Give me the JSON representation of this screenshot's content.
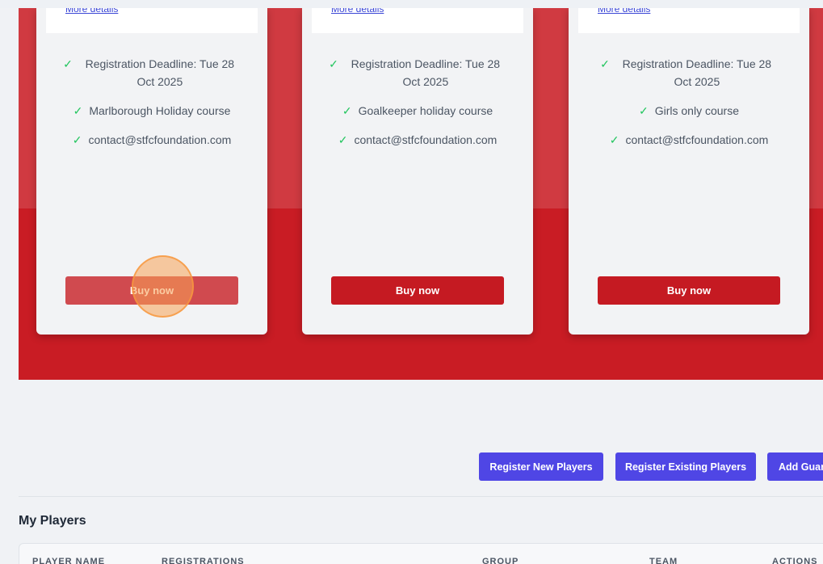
{
  "courses": [
    {
      "more_link": "More details",
      "deadline": "Registration Deadline: Tue 28 Oct 2025",
      "description": "Marlborough Holiday course",
      "contact": "contact@stfcfoundation.com",
      "buy_label": "Buy now"
    },
    {
      "more_link": "More details",
      "deadline": "Registration Deadline: Tue 28 Oct 2025",
      "description": "Goalkeeper holiday course",
      "contact": "contact@stfcfoundation.com",
      "buy_label": "Buy now"
    },
    {
      "more_link": "More details",
      "deadline": "Registration Deadline: Tue 28 Oct 2025",
      "description": "Girls only course",
      "contact": "contact@stfcfoundation.com",
      "buy_label": "Buy now"
    }
  ],
  "actions": {
    "register_new": "Register New Players",
    "register_existing": "Register Existing Players",
    "add_guardian": "Add Guar"
  },
  "players": {
    "title": "My Players",
    "columns": [
      "PLAYER NAME",
      "REGISTRATIONS",
      "GROUP",
      "TEAM",
      "ACTIONS"
    ]
  },
  "icons": {
    "check": "check-icon"
  },
  "colors": {
    "hero_red": "#c91c24",
    "buy_button": "#c51a22",
    "action_button": "#4f46e5",
    "check_green": "#22c55e",
    "link_blue": "#3b47d6"
  }
}
